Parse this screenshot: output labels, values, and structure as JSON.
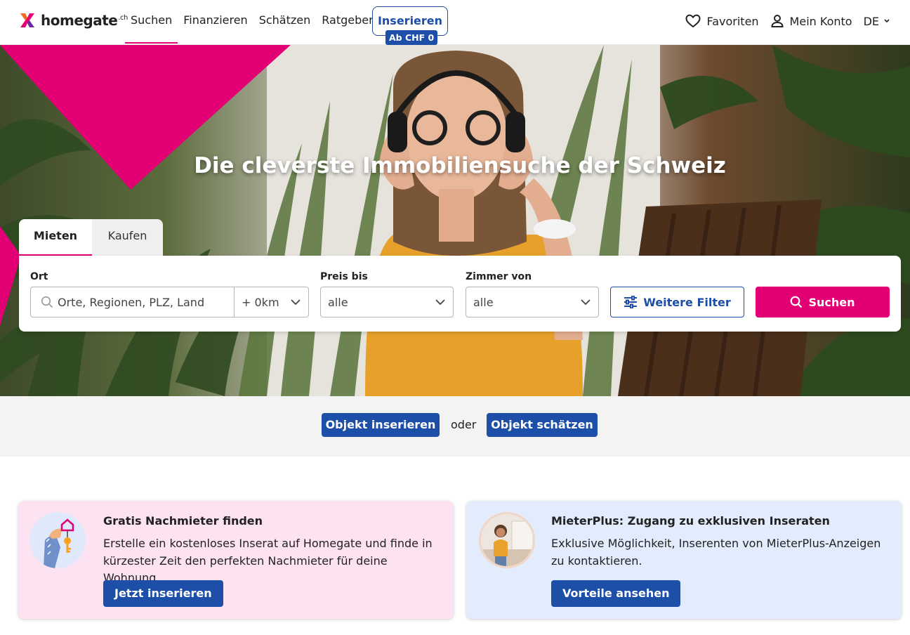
{
  "header": {
    "logo_text": "homegate",
    "logo_suffix": ".ch",
    "nav": [
      {
        "label": "Suchen"
      },
      {
        "label": "Finanzieren"
      },
      {
        "label": "Schätzen"
      },
      {
        "label": "Ratgeber"
      }
    ],
    "insert_label": "Inserieren",
    "insert_badge": "Ab CHF 0",
    "favorites_label": "Favoriten",
    "account_label": "Mein Konto",
    "language": "DE"
  },
  "hero": {
    "title": "Die cleverste Immobiliensuche der Schweiz"
  },
  "search": {
    "tabs": [
      {
        "label": "Mieten",
        "active": true
      },
      {
        "label": "Kaufen",
        "active": false
      }
    ],
    "location_label": "Ort",
    "location_placeholder": "Orte, Regionen, PLZ, Land",
    "radius_value": "+ 0km",
    "price_label": "Preis bis",
    "price_value": "alle",
    "rooms_label": "Zimmer von",
    "rooms_value": "alle",
    "more_filters_label": "Weitere Filter",
    "search_button_label": "Suchen"
  },
  "cta": {
    "insert_label": "Objekt inserieren",
    "or_label": "oder",
    "estimate_label": "Objekt schätzen"
  },
  "cards": [
    {
      "title": "Gratis Nachmieter finden",
      "text": "Erstelle ein kostenloses Inserat auf Homegate und finde in kürzester Zeit den perfekten Nachmieter für deine Wohnung.",
      "button": "Jetzt inserieren"
    },
    {
      "title": "MieterPlus: Zugang zu exklusiven Inseraten",
      "text": "Exklusive Möglichkeit, Inserenten von MieterPlus-Anzeigen zu kontaktieren.",
      "button": "Vorteile ansehen"
    }
  ],
  "colors": {
    "brand_pink": "#e20074",
    "brand_blue": "#1d4ea8",
    "card_pink_bg": "#fde3f1",
    "card_blue_bg": "#e3ecfd"
  }
}
